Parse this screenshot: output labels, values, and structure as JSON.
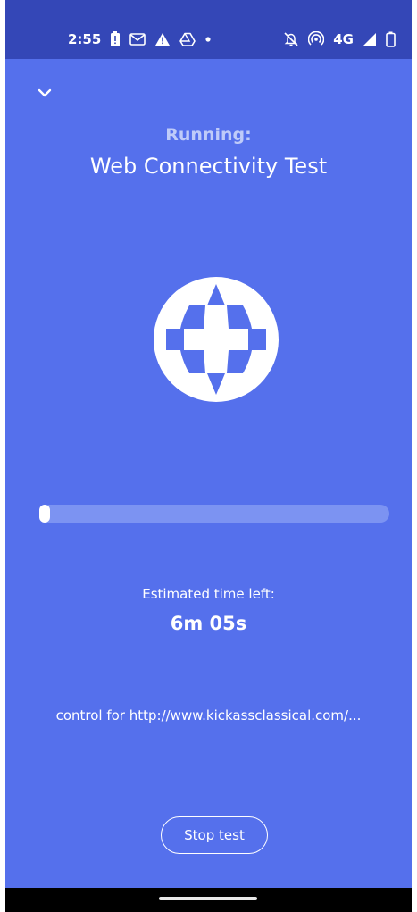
{
  "status_bar": {
    "time": "2:55",
    "network_label": "4G",
    "icons_left": [
      "battery-alert-icon",
      "gmail-icon",
      "warning-icon",
      "drive-icon",
      "dot-icon"
    ],
    "icons_right": [
      "notifications-off-icon",
      "hotspot-icon",
      "network-4g",
      "signal-icon",
      "battery-icon"
    ]
  },
  "header": {
    "collapse_icon": "chevron-down-icon",
    "running_label": "Running:",
    "test_name": "Web Connectivity Test"
  },
  "test_icon": "globe-icon",
  "progress": {
    "value_percent": 2
  },
  "eta": {
    "label": "Estimated time left:",
    "value": "6m 05s"
  },
  "log_line": "control for http://www.kickassclassical.com/...",
  "stop_button": {
    "label": "Stop test"
  },
  "colors": {
    "background": "#5570EC",
    "status_bar": "#3447B7",
    "progress_track": "#7C93F2",
    "running_label": "#BFCBF9"
  }
}
